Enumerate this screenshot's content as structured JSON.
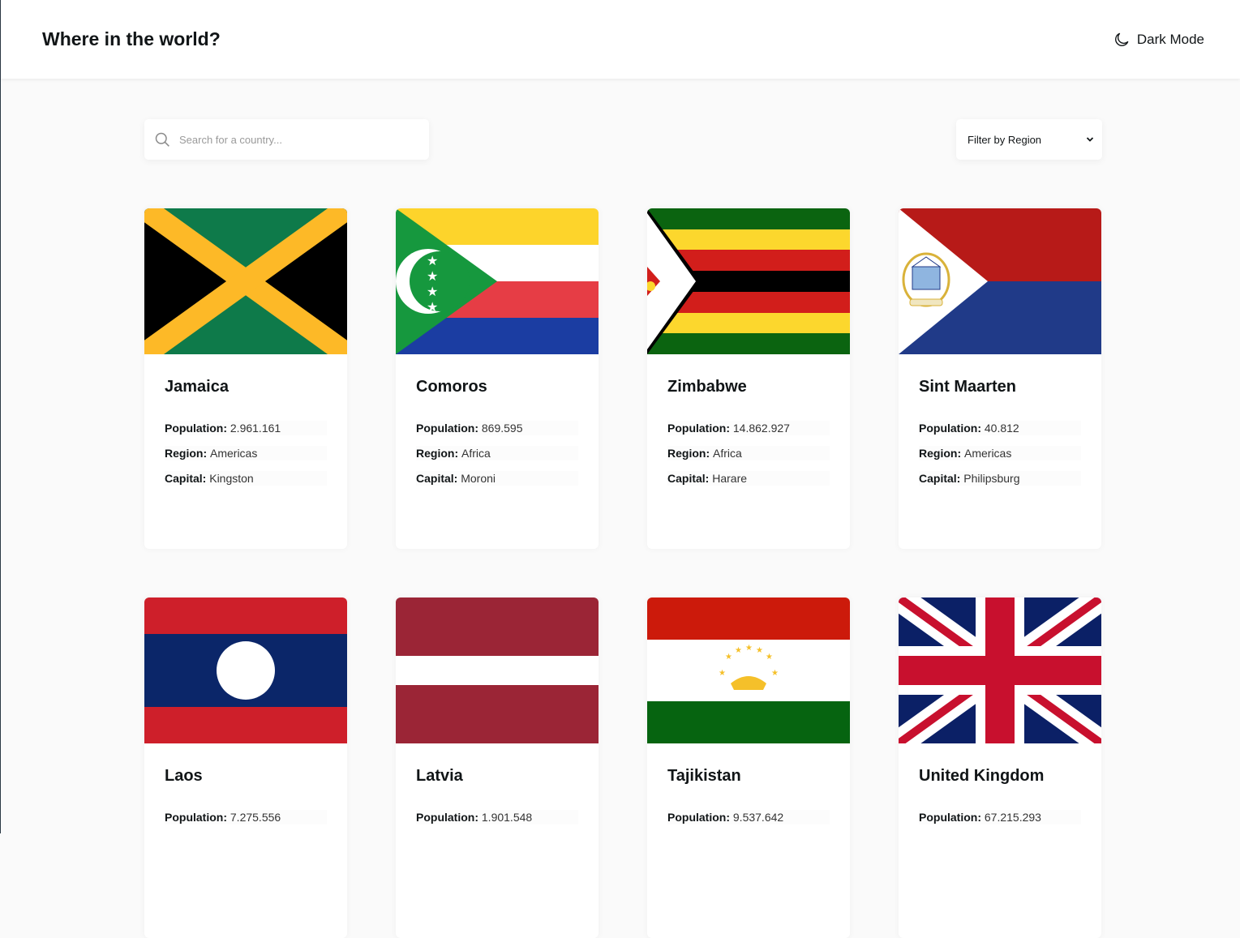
{
  "header": {
    "title": "Where in the world?",
    "mode_label": "Dark Mode"
  },
  "search": {
    "placeholder": "Search for a country..."
  },
  "filter": {
    "label": "Filter by Region"
  },
  "labels": {
    "population": "Population:",
    "region": "Region:",
    "capital": "Capital:"
  },
  "countries": [
    {
      "name": "Jamaica",
      "population": "2.961.161",
      "region": "Americas",
      "capital": "Kingston"
    },
    {
      "name": "Comoros",
      "population": "869.595",
      "region": "Africa",
      "capital": "Moroni"
    },
    {
      "name": "Zimbabwe",
      "population": "14.862.927",
      "region": "Africa",
      "capital": "Harare"
    },
    {
      "name": "Sint Maarten",
      "population": "40.812",
      "region": "Americas",
      "capital": "Philipsburg"
    },
    {
      "name": "Laos",
      "population": "7.275.556"
    },
    {
      "name": "Latvia",
      "population": "1.901.548"
    },
    {
      "name": "Tajikistan",
      "population": "9.537.642"
    },
    {
      "name": "United Kingdom",
      "population": "67.215.293"
    }
  ]
}
